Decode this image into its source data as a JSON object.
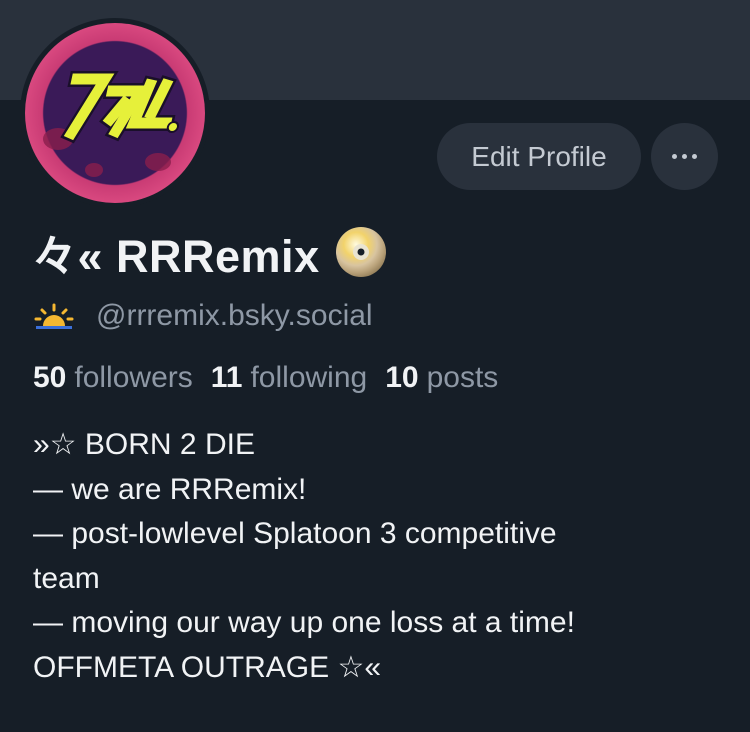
{
  "profile": {
    "display_name": "々« RRRemix",
    "handle_emoji_icon": "sunrise-icon",
    "name_emoji_icon": "dvd-disc-icon",
    "handle": "@rrremix.bsky.social",
    "avatar_logo_text": "ノマに",
    "colors": {
      "background": "#161e27",
      "banner": "#29313c",
      "button_bg": "#29313c",
      "muted_text": "#8e98a5",
      "avatar_pink": "#d8487f",
      "avatar_purple": "#3a1a58",
      "avatar_yellow": "#e6f03a"
    }
  },
  "actions": {
    "edit_profile_label": "Edit Profile",
    "more_icon": "ellipsis-icon"
  },
  "stats": {
    "followers_count": "50",
    "followers_label": "followers",
    "following_count": "11",
    "following_label": "following",
    "posts_count": "10",
    "posts_label": "posts"
  },
  "bio": {
    "lines": [
      "»☆ BORN 2 DIE",
      "— we are RRRemix!",
      "— post-lowlevel Splatoon 3 competitive",
      "team",
      "— moving our way up one loss at a time!",
      "OFFMETA OUTRAGE ☆«"
    ]
  }
}
